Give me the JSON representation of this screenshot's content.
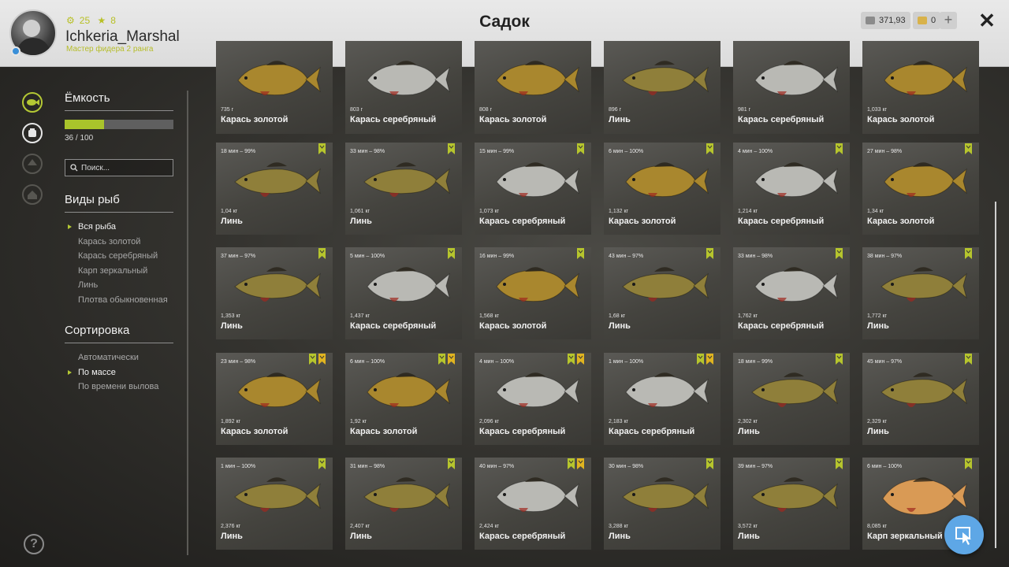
{
  "header": {
    "title": "Садок",
    "username": "Ichkeria_Marshal",
    "rank": "Мастер фидера 2 ранга",
    "coins": "25",
    "stars": "8",
    "silver": "371,93",
    "gold": "0",
    "close": "✕",
    "plus": "+"
  },
  "panel": {
    "capacity_label": "Ёмкость",
    "capacity_value": "36 / 100",
    "capacity_fraction": 0.36,
    "search_placeholder": "Поиск...",
    "species_title": "Виды рыб",
    "species": [
      "Вся рыба",
      "Карась золотой",
      "Карась серебряный",
      "Карп зеркальный",
      "Линь",
      "Плотва обыкновенная"
    ],
    "species_selected": 0,
    "sort_title": "Сортировка",
    "sorts": [
      "Автоматически",
      "По массе",
      "По времени вылова"
    ],
    "sort_selected": 1
  },
  "help": "?",
  "fish": [
    {
      "time": "",
      "weight": "735 г",
      "name": "Карась золотой",
      "type": "gold",
      "badges": []
    },
    {
      "time": "",
      "weight": "803 г",
      "name": "Карась серебряный",
      "type": "silver",
      "badges": []
    },
    {
      "time": "",
      "weight": "808 г",
      "name": "Карась золотой",
      "type": "gold",
      "badges": []
    },
    {
      "time": "",
      "weight": "896 г",
      "name": "Линь",
      "type": "tench",
      "badges": []
    },
    {
      "time": "",
      "weight": "981 г",
      "name": "Карась серебряный",
      "type": "silver",
      "badges": []
    },
    {
      "time": "",
      "weight": "1,033 кг",
      "name": "Карась золотой",
      "type": "gold",
      "badges": []
    },
    {
      "time": "18 мин – 99%",
      "weight": "1,04 кг",
      "name": "Линь",
      "type": "tench",
      "badges": [
        "green"
      ]
    },
    {
      "time": "33 мин – 98%",
      "weight": "1,061 кг",
      "name": "Линь",
      "type": "tench",
      "badges": [
        "green"
      ]
    },
    {
      "time": "15 мин – 99%",
      "weight": "1,073 кг",
      "name": "Карась серебряный",
      "type": "silver",
      "badges": [
        "green"
      ]
    },
    {
      "time": "6 мин – 100%",
      "weight": "1,132 кг",
      "name": "Карась золотой",
      "type": "gold",
      "badges": [
        "green"
      ]
    },
    {
      "time": "4 мин – 100%",
      "weight": "1,214 кг",
      "name": "Карась серебряный",
      "type": "silver",
      "badges": [
        "green"
      ]
    },
    {
      "time": "27 мин – 98%",
      "weight": "1,34 кг",
      "name": "Карась золотой",
      "type": "gold",
      "badges": [
        "green"
      ]
    },
    {
      "time": "37 мин – 97%",
      "weight": "1,353 кг",
      "name": "Линь",
      "type": "tench",
      "badges": [
        "green"
      ]
    },
    {
      "time": "5 мин – 100%",
      "weight": "1,437 кг",
      "name": "Карась серебряный",
      "type": "silver",
      "badges": [
        "green"
      ]
    },
    {
      "time": "16 мин – 99%",
      "weight": "1,568 кг",
      "name": "Карась золотой",
      "type": "gold",
      "badges": [
        "green"
      ]
    },
    {
      "time": "43 мин – 97%",
      "weight": "1,68 кг",
      "name": "Линь",
      "type": "tench",
      "badges": [
        "green"
      ]
    },
    {
      "time": "33 мин – 98%",
      "weight": "1,762 кг",
      "name": "Карась серебряный",
      "type": "silver",
      "badges": [
        "green"
      ]
    },
    {
      "time": "38 мин – 97%",
      "weight": "1,772 кг",
      "name": "Линь",
      "type": "tench",
      "badges": [
        "green"
      ]
    },
    {
      "time": "23 мин – 98%",
      "weight": "1,892 кг",
      "name": "Карась золотой",
      "type": "gold",
      "badges": [
        "green",
        "gold"
      ]
    },
    {
      "time": "6 мин – 100%",
      "weight": "1,92 кг",
      "name": "Карась золотой",
      "type": "gold",
      "badges": [
        "green",
        "gold"
      ]
    },
    {
      "time": "4 мин – 100%",
      "weight": "2,096 кг",
      "name": "Карась серебряный",
      "type": "silver",
      "badges": [
        "green",
        "gold"
      ]
    },
    {
      "time": "1 мин – 100%",
      "weight": "2,183 кг",
      "name": "Карась серебряный",
      "type": "silver",
      "badges": [
        "green",
        "gold"
      ]
    },
    {
      "time": "18 мин – 99%",
      "weight": "2,302 кг",
      "name": "Линь",
      "type": "tench",
      "badges": [
        "green"
      ]
    },
    {
      "time": "45 мин – 97%",
      "weight": "2,329 кг",
      "name": "Линь",
      "type": "tench",
      "badges": [
        "green"
      ]
    },
    {
      "time": "1 мин – 100%",
      "weight": "2,376 кг",
      "name": "Линь",
      "type": "tench",
      "badges": [
        "green"
      ]
    },
    {
      "time": "31 мин – 98%",
      "weight": "2,407 кг",
      "name": "Линь",
      "type": "tench",
      "badges": [
        "green"
      ]
    },
    {
      "time": "40 мин – 97%",
      "weight": "2,424 кг",
      "name": "Карась серебряный",
      "type": "silver",
      "badges": [
        "green",
        "gold"
      ]
    },
    {
      "time": "30 мин – 98%",
      "weight": "3,288 кг",
      "name": "Линь",
      "type": "tench",
      "badges": [
        "green"
      ]
    },
    {
      "time": "39 мин – 97%",
      "weight": "3,572 кг",
      "name": "Линь",
      "type": "tench",
      "badges": [
        "green"
      ]
    },
    {
      "time": "6 мин – 100%",
      "weight": "8,085 кг",
      "name": "Карп зеркальный",
      "type": "carp",
      "badges": [
        "green"
      ]
    }
  ],
  "colors": {
    "accent": "#b4c834",
    "gold_fish": "#a9872e",
    "silver_fish": "#b9b9b4",
    "tench_fish": "#8f7f3a",
    "carp_fish": "#d99a55",
    "badge_green": "#b6c52d",
    "badge_gold": "#e0b420"
  }
}
